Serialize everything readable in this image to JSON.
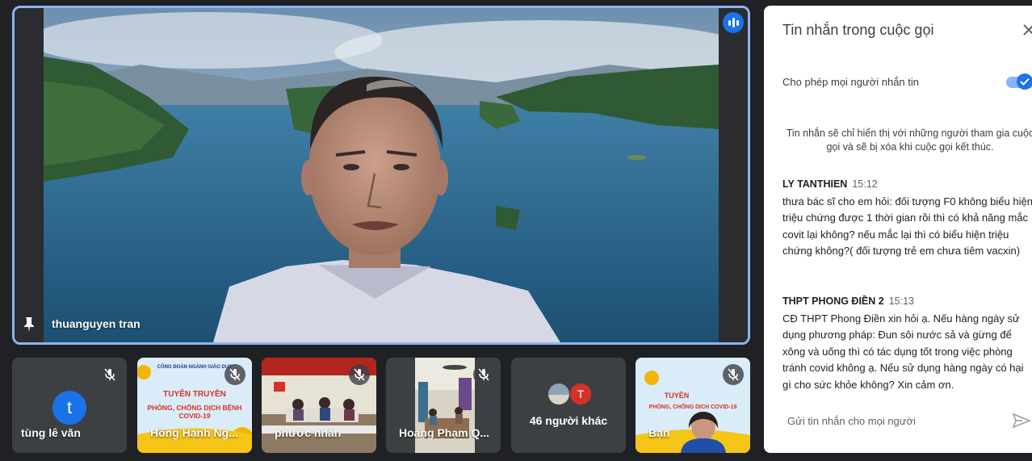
{
  "main_video": {
    "participant_name": "thuanguyen tran",
    "pin_icon": "pin-icon",
    "speaking_icon": "audio-level-icon"
  },
  "tiles": [
    {
      "name": "tùng lê văn",
      "avatar_letter": "t",
      "mic_icon": "mic-off-icon"
    },
    {
      "name": "Hồng Hạnh Ng...",
      "poster_line1": "CÔNG ĐOÀN NGÀNH GIÁO DỤC",
      "poster_line2": "TUYÊN TRUYỀN",
      "poster_line3": "PHÒNG, CHỐNG DỊCH BỆNH COVID-19",
      "mic_icon": "mic-off-icon"
    },
    {
      "name": "phước nhàn",
      "mic_icon": "mic-off-icon"
    },
    {
      "name": "Hoàng Phạm Q...",
      "mic_icon": "mic-off-icon"
    },
    {
      "label": "46 người khác",
      "avatar_letter": "T"
    },
    {
      "name": "Bạn",
      "poster_line2": "TUYÊN",
      "poster_line3": "PHÒNG, CHỐNG DỊCH COVID-19",
      "mic_icon": "mic-off-icon"
    }
  ],
  "chat": {
    "title": "Tin nhắn trong cuộc gọi",
    "close_icon": "close-icon",
    "allow_label": "Cho phép mọi người nhắn tin",
    "allow_enabled": true,
    "notice": "Tin nhắn sẽ chỉ hiển thị với những người tham gia cuộc gọi và sẽ bị xóa khi cuộc gọi kết thúc.",
    "messages": [
      {
        "sender": "LY TANTHIEN",
        "time": "15:12",
        "text": "thưa bác sĩ cho em hỏi: đối tượng F0 không biểu hiện triệu chứng được 1 thời gian rồi thì có khả năng mắc covit lại không? nếu mắc lại thì có biểu hiện triệu chứng không?( đối tượng trẻ em chưa tiêm vacxin)"
      },
      {
        "sender": "THPT PHONG ĐIỀN 2",
        "time": "15:13",
        "text": "CĐ THPT Phong Điền xin hỏi ạ. Nếu hàng ngày sử dụng phương pháp: Đun sôi nước sả và gừng để xông và uống thì có tác dụng tốt trong việc phòng tránh covid không ạ. Nếu sử dụng hàng ngày có hại gì cho sức khỏe không? Xin cảm ơn."
      }
    ],
    "compose_placeholder": "Gửi tin nhắn cho mọi người",
    "send_icon": "send-icon"
  },
  "colors": {
    "background": "#202124",
    "accent": "#1a73e8",
    "active_border": "#8ab4f8",
    "tile_bg": "#3c4043",
    "avatar_orange": "#d93025"
  }
}
